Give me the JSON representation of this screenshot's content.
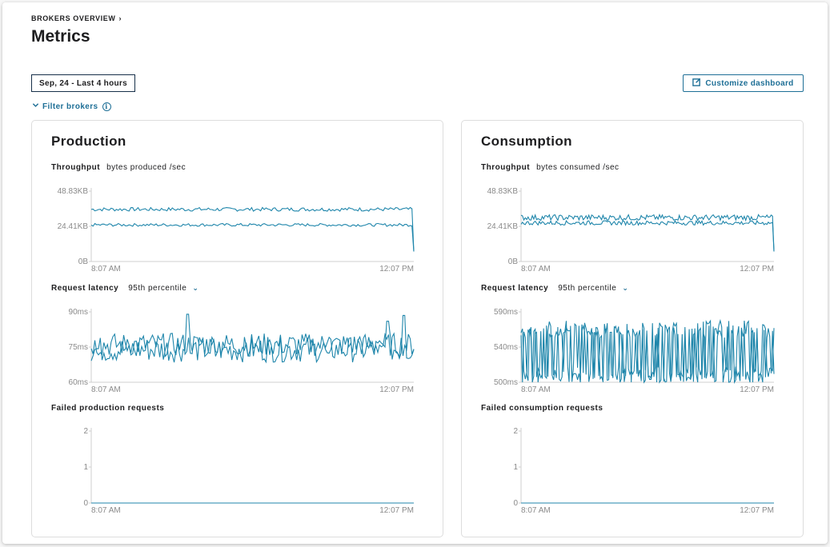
{
  "breadcrumb": {
    "label": "BROKERS OVERVIEW",
    "chevron": "›"
  },
  "page": {
    "title": "Metrics"
  },
  "toolbar": {
    "date_range": "Sep, 24 - Last 4 hours",
    "customize_label": "Customize dashboard",
    "customize_icon": "edit-square-icon",
    "filter_label": "Filter brokers",
    "filter_icon": "chevron-down-icon",
    "info_icon": "info-icon",
    "info_glyph": "i"
  },
  "colors": {
    "accent": "#1e6f96",
    "line": "#1f86ab",
    "axis": "#cfcfcf",
    "text": "#1d1d1f",
    "muted": "#8a8a8a"
  },
  "panels": [
    {
      "title": "Production",
      "throughput": {
        "label": "Throughput",
        "sub": "bytes produced /sec"
      },
      "latency": {
        "label": "Request latency",
        "select": "95th percentile",
        "caret": "⌄"
      },
      "failed": {
        "label": "Failed production requests"
      }
    },
    {
      "title": "Consumption",
      "throughput": {
        "label": "Throughput",
        "sub": "bytes consumed /sec"
      },
      "latency": {
        "label": "Request latency",
        "select": "95th percentile",
        "caret": "⌄"
      },
      "failed": {
        "label": "Failed consumption requests"
      }
    }
  ],
  "chart_data": [
    {
      "panel": "Production",
      "metric": "Throughput",
      "type": "line",
      "x_range": [
        "8:07 AM",
        "12:07 PM"
      ],
      "x_ticks": [
        "8:07 AM",
        "12:07 PM"
      ],
      "y_ticks": [
        "0B",
        "24.41KB",
        "48.83KB"
      ],
      "ylim": [
        0,
        48.83
      ],
      "y_unit": "KB",
      "series": [
        {
          "base": 36.2,
          "noise": 1.3,
          "end": 7
        },
        {
          "base": 25.4,
          "noise": 1.0,
          "end": 7
        }
      ]
    },
    {
      "panel": "Production",
      "metric": "Request latency",
      "type": "line",
      "x_range": [
        "8:07 AM",
        "12:07 PM"
      ],
      "x_ticks": [
        "8:07 AM",
        "12:07 PM"
      ],
      "y_ticks": [
        "60ms",
        "75ms",
        "90ms"
      ],
      "ylim": [
        60,
        90
      ],
      "y_unit": "ms",
      "series": [
        {
          "base": 74,
          "noise": 5.5,
          "spikes": [
            [
              0.3,
              89
            ],
            [
              0.97,
              88.5
            ],
            [
              0.92,
              86
            ]
          ]
        },
        {
          "base": 76,
          "noise": 5.0
        }
      ]
    },
    {
      "panel": "Production",
      "metric": "Failed production requests",
      "type": "line",
      "x_range": [
        "8:07 AM",
        "12:07 PM"
      ],
      "x_ticks": [
        "8:07 AM",
        "12:07 PM"
      ],
      "y_ticks": [
        "0",
        "1",
        "2"
      ],
      "ylim": [
        0,
        2
      ],
      "series": [
        {
          "base": 0,
          "noise": 0
        }
      ]
    },
    {
      "panel": "Consumption",
      "metric": "Throughput",
      "type": "line",
      "x_range": [
        "8:07 AM",
        "12:07 PM"
      ],
      "x_ticks": [
        "8:07 AM",
        "12:07 PM"
      ],
      "y_ticks": [
        "0B",
        "24.41KB",
        "48.83KB"
      ],
      "ylim": [
        0,
        48.83
      ],
      "y_unit": "KB",
      "series": [
        {
          "base": 30.5,
          "noise": 2.0,
          "end": 7
        },
        {
          "base": 26.8,
          "noise": 1.5,
          "end": 7
        }
      ]
    },
    {
      "panel": "Consumption",
      "metric": "Request latency",
      "type": "line",
      "x_range": [
        "8:07 AM",
        "12:07 PM"
      ],
      "x_ticks": [
        "8:07 AM",
        "12:07 PM"
      ],
      "y_ticks": [
        "500ms",
        "540ms",
        "590ms"
      ],
      "ylim": [
        500,
        590
      ],
      "y_unit": "ms",
      "series": [
        {
          "base": 548,
          "noise": 20,
          "high": 570,
          "low": 510
        },
        {
          "base": 525,
          "noise": 16,
          "high": 565,
          "low": 506
        }
      ]
    },
    {
      "panel": "Consumption",
      "metric": "Failed consumption requests",
      "type": "line",
      "x_range": [
        "8:07 AM",
        "12:07 PM"
      ],
      "x_ticks": [
        "8:07 AM",
        "12:07 PM"
      ],
      "y_ticks": [
        "0",
        "1",
        "2"
      ],
      "ylim": [
        0,
        2
      ],
      "series": [
        {
          "base": 0,
          "noise": 0
        }
      ]
    }
  ]
}
